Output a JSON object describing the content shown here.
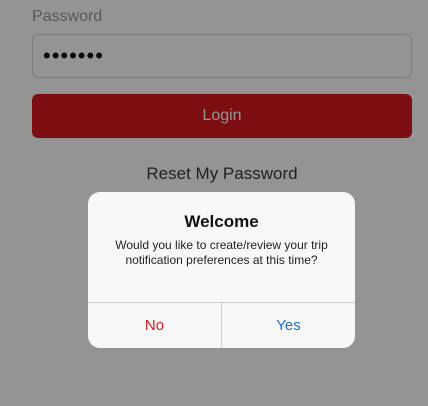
{
  "form": {
    "password_label": "Password",
    "password_value": "•••••••",
    "login_label": "Login",
    "reset_label": "Reset My Password"
  },
  "dialog": {
    "title": "Welcome",
    "message": "Would you like to create/review your trip notification preferences at this time?",
    "no_label": "No",
    "yes_label": "Yes"
  },
  "colors": {
    "primary_red": "#d6191f",
    "link_blue": "#1f6fd0"
  }
}
